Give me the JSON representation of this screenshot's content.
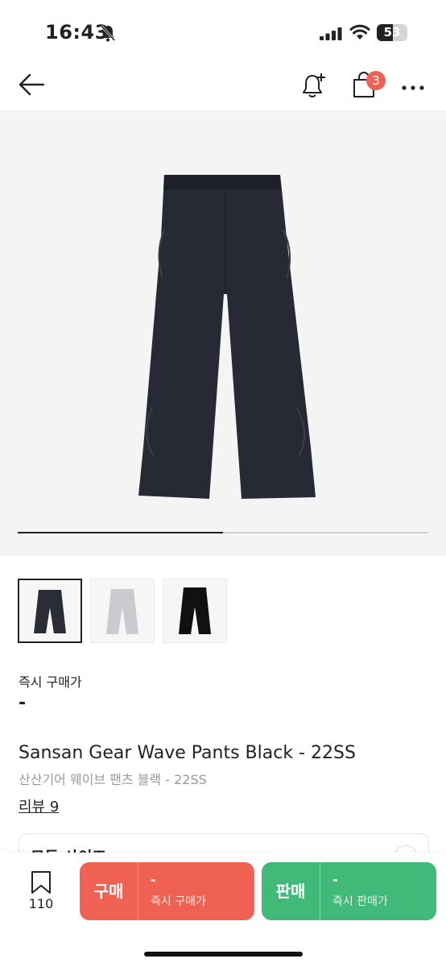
{
  "status": {
    "time": "16:43",
    "battery": "53",
    "battery_level": 0.53
  },
  "nav": {
    "cart_count": "3"
  },
  "gallery": {
    "progress": 0.5,
    "thumb_count": 3
  },
  "price": {
    "label": "즉시 구매가",
    "value": "-"
  },
  "product": {
    "title_en": "Sansan Gear Wave Pants Black - 22SS",
    "title_ko": "산산기어 웨이브 팬츠 블랙 - 22SS",
    "reviews": "리뷰 9"
  },
  "size_selector": {
    "label": "모든 사이즈"
  },
  "bottom": {
    "bookmark_count": "110",
    "buy": {
      "label": "구매",
      "price": "-",
      "sub": "즉시 구매가"
    },
    "sell": {
      "label": "판매",
      "price": "-",
      "sub": "즉시 판매가"
    }
  },
  "colors": {
    "buy": "#ef6253",
    "sell": "#41b979",
    "badge": "#ef6253"
  }
}
